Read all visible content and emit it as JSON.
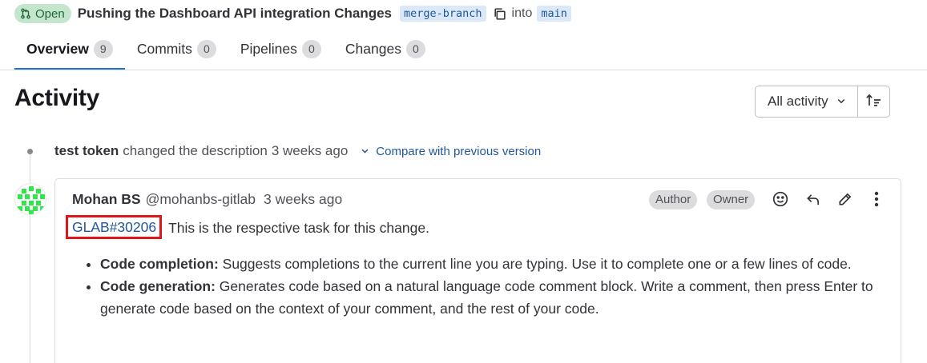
{
  "header": {
    "status": "Open",
    "title": "Pushing the Dashboard API integration Changes",
    "source_branch": "merge-branch",
    "into_text": "into",
    "target_branch": "main"
  },
  "tabs": [
    {
      "label": "Overview",
      "count": "9",
      "active": true
    },
    {
      "label": "Commits",
      "count": "0"
    },
    {
      "label": "Pipelines",
      "count": "0"
    },
    {
      "label": "Changes",
      "count": "0"
    }
  ],
  "activity": {
    "title": "Activity",
    "filter_label": "All activity"
  },
  "system_note": {
    "author": "test token",
    "action": "changed the description",
    "time": "3 weeks ago",
    "compare_link": "Compare with previous version"
  },
  "comment": {
    "author_name": "Mohan BS",
    "author_handle": "@mohanbs-gitlab",
    "time": "3 weeks ago",
    "badges": [
      "Author",
      "Owner"
    ],
    "reference": "GLAB#30206",
    "intro": "This is the respective task for this change.",
    "items": [
      {
        "title": "Code completion:",
        "text": "Suggests completions to the current line you are typing. Use it to complete one or a few lines of code."
      },
      {
        "title": "Code generation:",
        "text": "Generates code based on a natural language code comment block. Write a comment, then press Enter to generate code based on the context of your comment, and the rest of your code."
      }
    ]
  },
  "colors": {
    "accent": "#1f75cb",
    "link": "#1f5799",
    "open_badge_bg": "#c3e6cd",
    "open_badge_text": "#24663b",
    "highlight_box": "#e0161c"
  },
  "icons": {
    "status": "merge-request-icon",
    "copy": "copy-icon",
    "dropdown": "chevron-down-icon",
    "sort": "sort-ascending-icon",
    "compare": "chevron-down-icon",
    "emoji": "smile-icon",
    "reply": "reply-icon",
    "edit": "pencil-icon",
    "more": "ellipsis-v-icon"
  }
}
